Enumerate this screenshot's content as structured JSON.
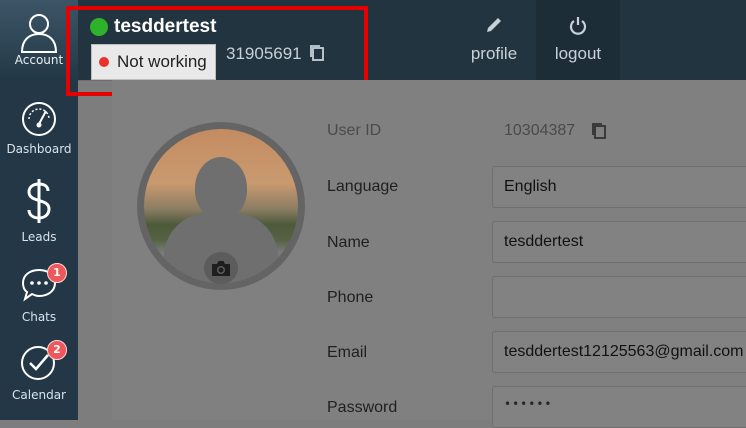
{
  "sidebar": {
    "account_label": "Account",
    "items": [
      {
        "label": "Dashboard",
        "icon": "speedometer-icon"
      },
      {
        "label": "Leads",
        "icon": "dollar-icon"
      },
      {
        "label": "Chats",
        "icon": "chat-bubble-icon",
        "badge": "1"
      },
      {
        "label": "Calendar",
        "icon": "check-circle-icon",
        "badge": "2"
      }
    ]
  },
  "header": {
    "username": "tesddertest",
    "status_label": "Not working",
    "phone_partial": "31905691",
    "profile_label": "profile",
    "logout_label": "logout"
  },
  "form": {
    "user_id_label": "User ID",
    "user_id_value": "10304387",
    "language_label": "Language",
    "language_value": "English",
    "name_label": "Name",
    "name_value": "tesddertest",
    "phone_label": "Phone",
    "phone_value": "",
    "email_label": "Email",
    "email_value": "tesddertest12125563@gmail.com",
    "password_label": "Password",
    "password_value": "••••••"
  },
  "colors": {
    "sidebar_bg": "#233746",
    "topbar_bg": "#22343f",
    "status_online": "#2db22a",
    "status_not_working": "#e8302d",
    "badge": "#f0575a",
    "highlight": "#e60000"
  }
}
